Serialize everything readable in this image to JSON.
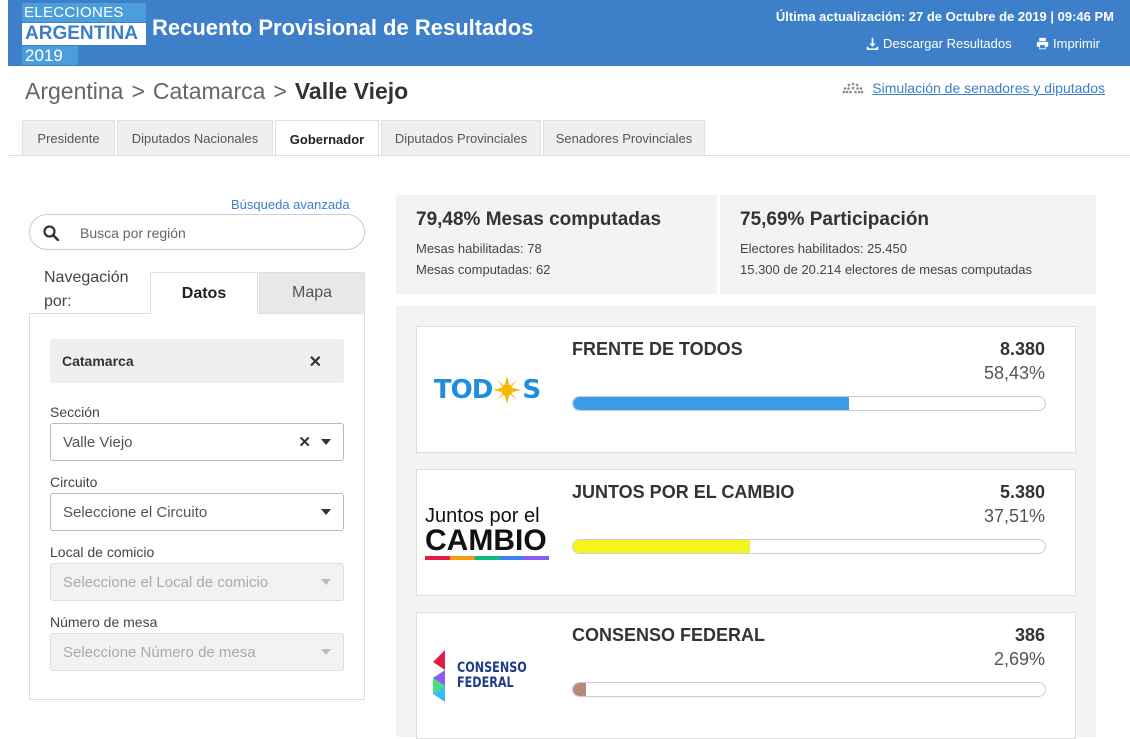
{
  "header": {
    "logo_line1": "ELECCIONES",
    "logo_line2": "ARGENTINA",
    "logo_line3": "2019",
    "title": "Recuento Provisional de Resultados",
    "last_update": "Última actualización: 27 de Octubre de 2019 | 09:46 PM",
    "download_label": "Descargar Resultados",
    "print_label": "Imprimir"
  },
  "breadcrumb": {
    "items": [
      "Argentina",
      ">",
      "Catamarca",
      ">"
    ],
    "current": "Valle Viejo"
  },
  "simulation_link": "Simulación de senadores y diputados",
  "tabs": [
    {
      "label": "Presidente",
      "active": false
    },
    {
      "label": "Diputados Nacionales",
      "active": false
    },
    {
      "label": "Gobernador",
      "active": true
    },
    {
      "label": "Diputados Provinciales",
      "active": false
    },
    {
      "label": "Senadores Provinciales",
      "active": false
    }
  ],
  "sidebar": {
    "advanced_search": "Búsqueda avanzada",
    "search_placeholder": "Busca por región",
    "nav_label": "Navegación por:",
    "subtab_datos": "Datos",
    "subtab_mapa": "Mapa",
    "selected_chip": "Catamarca",
    "seccion_label": "Sección",
    "seccion_value": "Valle Viejo",
    "circuito_label": "Circuito",
    "circuito_placeholder": "Seleccione el Circuito",
    "local_label": "Local de comicio",
    "local_placeholder": "Seleccione el Local de comicio",
    "mesa_label": "Número de mesa",
    "mesa_placeholder": "Seleccione Número de mesa"
  },
  "stats": {
    "mesas_title": "79,48% Mesas computadas",
    "mesas_habilitadas": "Mesas habilitadas: 78",
    "mesas_computadas": "Mesas computadas: 62",
    "participacion_title": "75,69% Participación",
    "electores_habilitados": "Electores habilitados: 25.450",
    "electores_computados": "15.300 de 20.214 electores de mesas computadas"
  },
  "results": [
    {
      "name": "FRENTE DE TODOS",
      "votes": "8.380",
      "pct_label": "58,43%",
      "pct": 58.43,
      "color": "#3d9be9",
      "logo": "todos-logo"
    },
    {
      "name": "JUNTOS POR EL CAMBIO",
      "votes": "5.380",
      "pct_label": "37,51%",
      "pct": 37.51,
      "color": "#f5f51e",
      "logo": "juntos-logo"
    },
    {
      "name": "CONSENSO FEDERAL",
      "votes": "386",
      "pct_label": "2,69%",
      "pct": 2.69,
      "color": "#b88a7a",
      "logo": "consenso-logo"
    }
  ],
  "logos": {
    "todos_pre": "TOD",
    "todos_post": "S",
    "juntos_line1": "Juntos por el",
    "juntos_line2": "CAMBIO",
    "consenso_line1": "CONSENSO",
    "consenso_line2": "FEDERAL"
  }
}
